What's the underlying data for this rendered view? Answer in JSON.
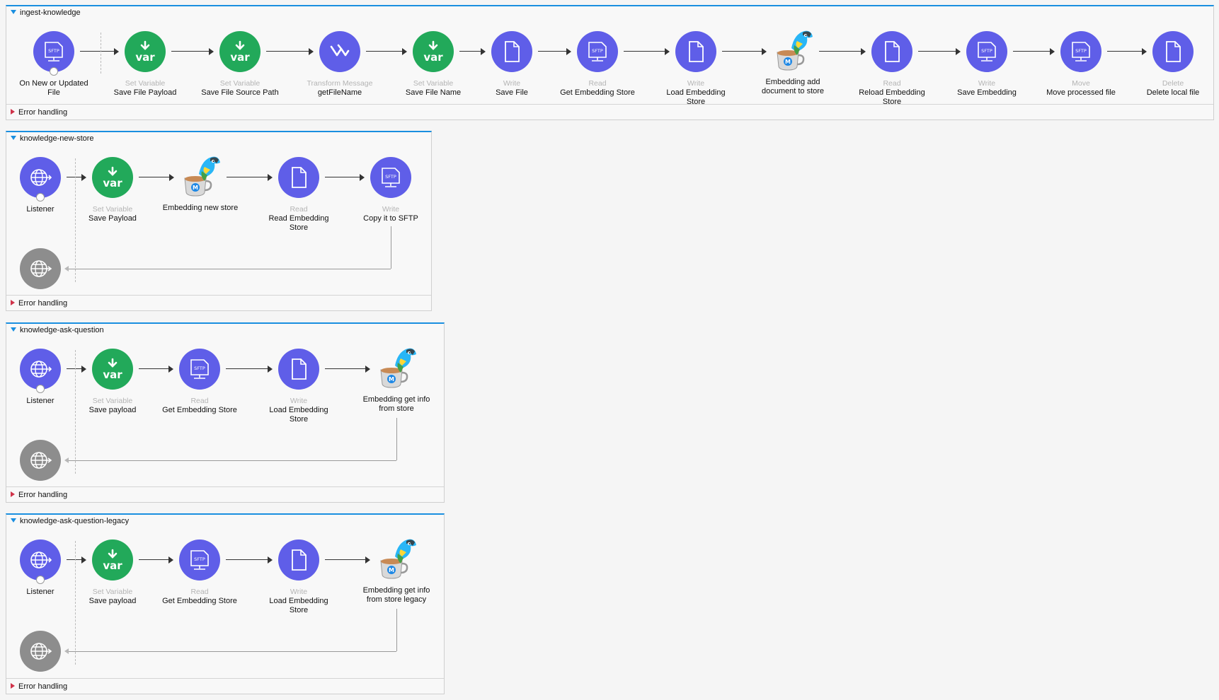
{
  "flows": [
    {
      "name": "ingest-knowledge",
      "error_label": "Error handling",
      "nodes": [
        {
          "type": "",
          "label": "On New or Updated File",
          "icon": "sftp-icon",
          "color": "blue"
        },
        {
          "type": "Set Variable",
          "label": "Save File Payload",
          "icon": "var-icon",
          "color": "green"
        },
        {
          "type": "Set Variable",
          "label": "Save File Source Path",
          "icon": "var-icon",
          "color": "green"
        },
        {
          "type": "Transform Message",
          "label": "getFileName",
          "icon": "transform-icon",
          "color": "blue"
        },
        {
          "type": "Set Variable",
          "label": "Save File Name",
          "icon": "var-icon",
          "color": "green"
        },
        {
          "type": "Write",
          "label": "Save File",
          "icon": "file-icon",
          "color": "blue"
        },
        {
          "type": "Read",
          "label": "Get Embedding Store",
          "icon": "sftp-icon",
          "color": "blue"
        },
        {
          "type": "Write",
          "label": "Load Embedding Store",
          "icon": "file-icon",
          "color": "blue"
        },
        {
          "type": "",
          "label": "Embedding add document to store",
          "icon": "mule-parrot-icon",
          "color": "mascot"
        },
        {
          "type": "Read",
          "label": "Reload Embedding Store",
          "icon": "file-icon",
          "color": "blue"
        },
        {
          "type": "Write",
          "label": "Save Embedding",
          "icon": "sftp-icon",
          "color": "blue"
        },
        {
          "type": "Move",
          "label": "Move processed file",
          "icon": "sftp-icon",
          "color": "blue"
        },
        {
          "type": "Delete",
          "label": "Delete local file",
          "icon": "file-icon",
          "color": "blue"
        }
      ]
    },
    {
      "name": "knowledge-new-store",
      "error_label": "Error handling",
      "nodes": [
        {
          "type": "",
          "label": "Listener",
          "icon": "http-listener-icon",
          "color": "blue"
        },
        {
          "type": "Set Variable",
          "label": "Save Payload",
          "icon": "var-icon",
          "color": "green"
        },
        {
          "type": "",
          "label": "Embedding new store",
          "icon": "mule-parrot-icon",
          "color": "mascot"
        },
        {
          "type": "Read",
          "label": "Read Embedding Store",
          "icon": "file-icon",
          "color": "blue"
        },
        {
          "type": "Write",
          "label": "Copy it to SFTP",
          "icon": "sftp-icon",
          "color": "blue"
        }
      ]
    },
    {
      "name": "knowledge-ask-question",
      "error_label": "Error handling",
      "nodes": [
        {
          "type": "",
          "label": "Listener",
          "icon": "http-listener-icon",
          "color": "blue"
        },
        {
          "type": "Set Variable",
          "label": "Save payload",
          "icon": "var-icon",
          "color": "green"
        },
        {
          "type": "Read",
          "label": "Get Embedding Store",
          "icon": "sftp-icon",
          "color": "blue"
        },
        {
          "type": "Write",
          "label": "Load Embedding Store",
          "icon": "file-icon",
          "color": "blue"
        },
        {
          "type": "",
          "label": "Embedding get info from store",
          "icon": "mule-parrot-icon",
          "color": "mascot"
        }
      ]
    },
    {
      "name": "knowledge-ask-question-legacy",
      "error_label": "Error handling",
      "nodes": [
        {
          "type": "",
          "label": "Listener",
          "icon": "http-listener-icon",
          "color": "blue"
        },
        {
          "type": "Set Variable",
          "label": "Save payload",
          "icon": "var-icon",
          "color": "green"
        },
        {
          "type": "Read",
          "label": "Get Embedding Store",
          "icon": "sftp-icon",
          "color": "blue"
        },
        {
          "type": "Write",
          "label": "Load Embedding Store",
          "icon": "file-icon",
          "color": "blue"
        },
        {
          "type": "",
          "label": "Embedding get info from store legacy",
          "icon": "mule-parrot-icon",
          "color": "mascot"
        }
      ]
    }
  ],
  "icon_text": {
    "sftp": "SFTP",
    "var": "var"
  },
  "colors": {
    "accent": "#1a8fe0",
    "blue": "#5f5ee8",
    "green": "#22a95a",
    "gray": "#8d8d8d",
    "error": "#d0334a"
  }
}
